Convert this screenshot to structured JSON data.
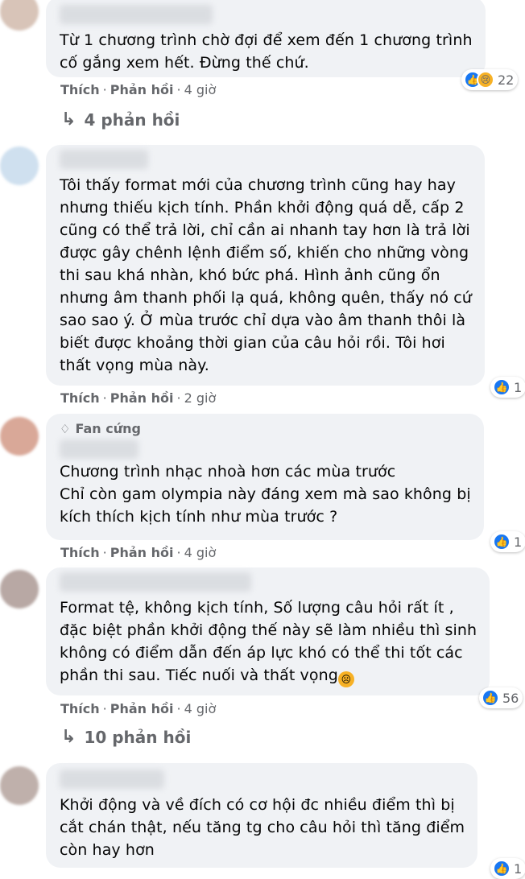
{
  "comments": [
    {
      "text": "Từ 1 chương trình chờ đợi để xem đến 1 chương trình\ncố gắng xem hết. Đừng thế chứ.",
      "like_label": "Thích",
      "reply_label": "Phản hồi",
      "time": "4 giờ",
      "reaction_count": "22",
      "reactions": [
        "like-icon",
        "sad-icon"
      ],
      "replies_label": "4 phản hồi"
    },
    {
      "text": "Tôi thấy format mới của chương trình cũng hay hay\nnhưng thiếu kịch tính. Phần khởi động quá dễ, cấp 2\ncũng có thể trả lời, chỉ cần ai nhanh tay hơn là trả lời\nđược gây chênh lệnh điểm số, khiến cho những vòng\nthi sau khá nhàn, khó bức phá. Hình ảnh cũng ổn\nnhưng âm thanh phối lạ quá, không quên, thấy nó cứ\nsao sao ý. Ở mùa trước chỉ dựa vào âm thanh thôi là\nbiết được khoảng thời gian của câu hỏi rồi. Tôi hơi\nthất vọng mùa này.",
      "like_label": "Thích",
      "reply_label": "Phản hồi",
      "time": "2 giờ",
      "reaction_count": "1",
      "reactions": [
        "like-icon"
      ]
    },
    {
      "badge": "Fan cứng",
      "text": "Chương trình nhạc nhoà hơn các mùa trước\nChỉ còn gam olympia này đáng xem mà sao không bị\nkích thích kịch tính như mùa trước ?",
      "like_label": "Thích",
      "reply_label": "Phản hồi",
      "time": "4 giờ",
      "reaction_count": "1",
      "reactions": [
        "like-icon"
      ]
    },
    {
      "text": "Format tệ, không kịch tính, Số lượng câu hỏi rất ít ,\nđặc biệt phần khởi động thế này sẽ làm nhiều thì sinh\nkhông có điểm dẫn đến áp lực khó có thể thi tốt các\nphần thi sau. Tiếc nuối và thất vọng",
      "like_label": "Thích",
      "reply_label": "Phản hồi",
      "time": "4 giờ",
      "reaction_count": "56",
      "reactions": [
        "like-icon"
      ],
      "replies_label": "10 phản hồi"
    },
    {
      "text": "Khởi động và về đích có cơ hội đc nhiều điểm thì bị\ncắt chán thật, nếu tăng tg cho câu hỏi thì tăng điểm\ncòn hay hơn",
      "reaction_count": "1",
      "reactions": [
        "like-icon"
      ]
    }
  ],
  "separator": "·"
}
